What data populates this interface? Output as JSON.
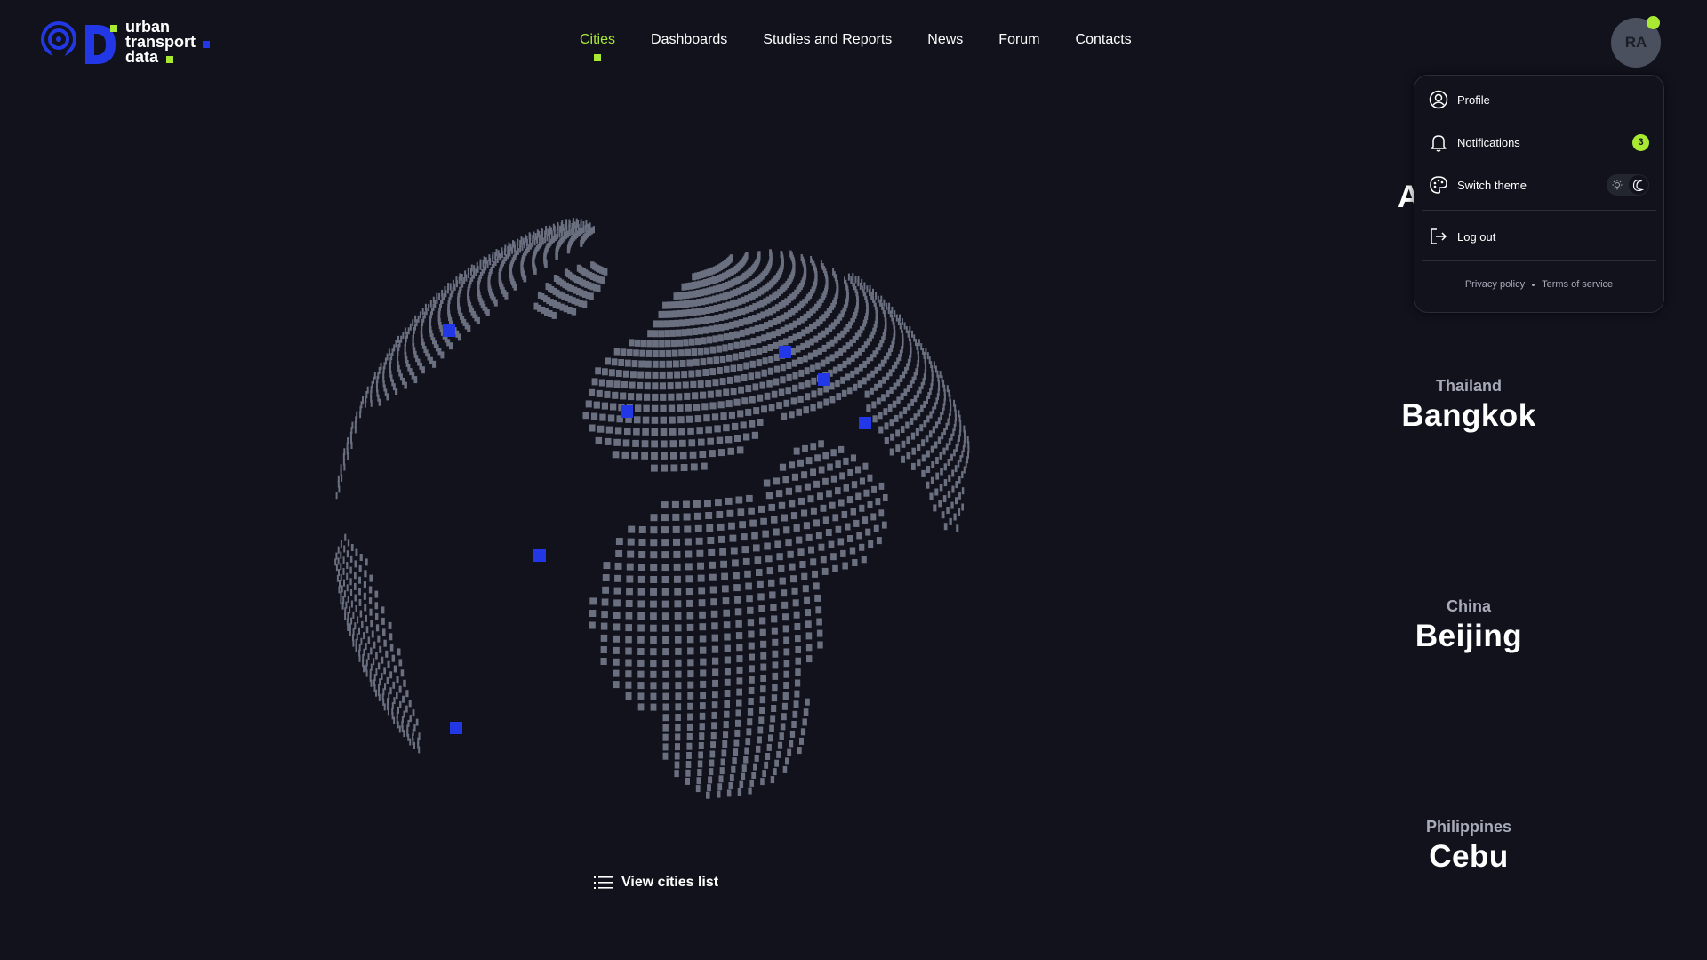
{
  "logo": {
    "line1": "urban",
    "line2": "transport",
    "line3": "data"
  },
  "nav": {
    "items": [
      {
        "label": "Cities",
        "active": true
      },
      {
        "label": "Dashboards"
      },
      {
        "label": "Studies and Reports"
      },
      {
        "label": "News"
      },
      {
        "label": "Forum"
      },
      {
        "label": "Contacts"
      }
    ]
  },
  "user": {
    "initials": "RA"
  },
  "menu": {
    "profile": "Profile",
    "notifications": "Notifications",
    "notifications_count": "3",
    "switch_theme": "Switch theme",
    "logout": "Log out",
    "privacy": "Privacy policy",
    "terms": "Terms of service"
  },
  "cities": [
    {
      "country": "Thailand",
      "name": "Bangkok"
    },
    {
      "country": "China",
      "name": "Beijing"
    },
    {
      "country": "Philippines",
      "name": "Cebu"
    }
  ],
  "partial_city_letter": "A",
  "globe": {
    "dot_color": "#6b7080",
    "marker_color": "#2238e6",
    "marker_count": 8
  },
  "view_list_label": "View cities list",
  "colors": {
    "accent": "#a9e934",
    "brand_blue": "#2238e6",
    "background": "#11121c"
  }
}
